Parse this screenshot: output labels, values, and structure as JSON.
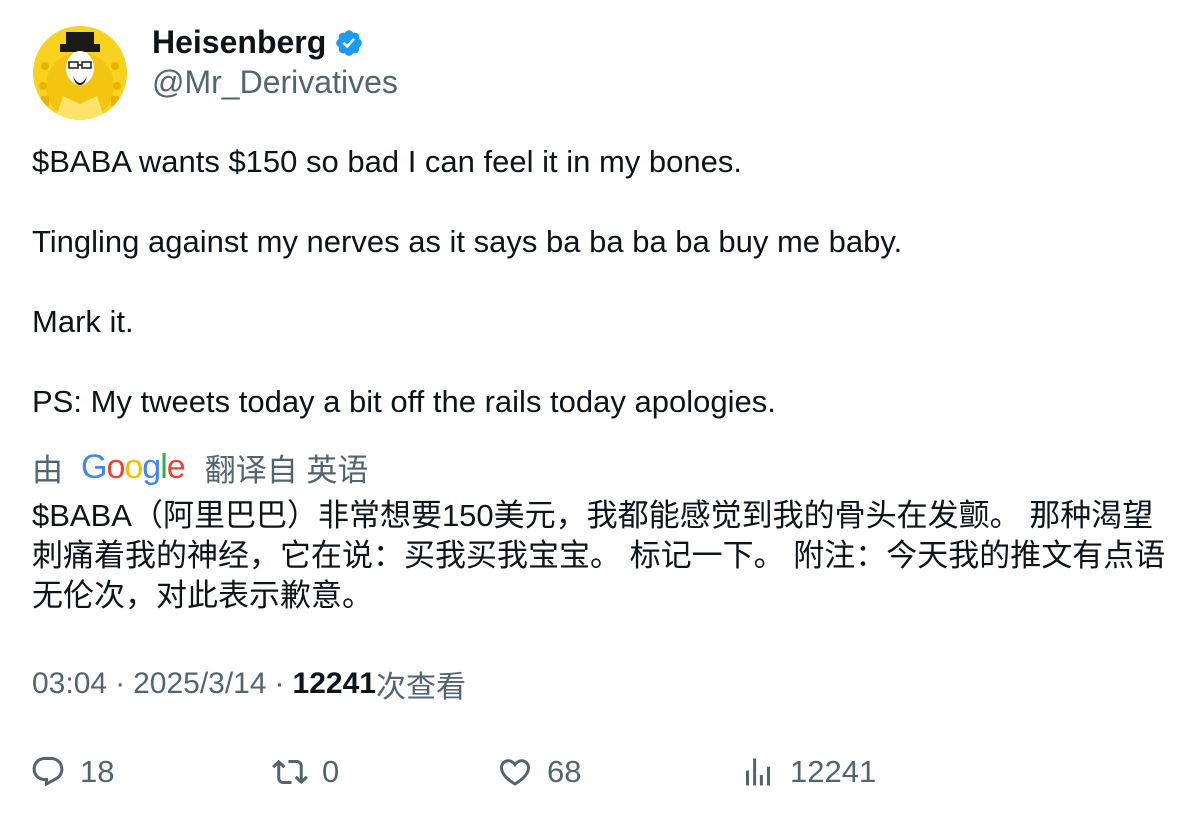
{
  "author": {
    "display_name": "Heisenberg",
    "handle": "@Mr_Derivatives",
    "verified": true,
    "avatar_icon": "heisenberg-avatar",
    "accent_color": "#1d9bf0"
  },
  "tweet": {
    "text": "$BABA wants $150 so bad I can feel it in my bones.\n\nTingling against my nerves as it says ba ba ba ba buy me baby.\n\nMark it.\n\nPS: My tweets today a bit off the rails today apologies."
  },
  "translation": {
    "by_label": "由",
    "provider": "Google",
    "from_label": "翻译自 英语",
    "text": "$BABA（阿里巴巴）非常想要150美元，我都能感觉到我的骨头在发颤。 那种渴望刺痛着我的神经，它在说：买我买我宝宝。 标记一下。 附注：今天我的推文有点语无伦次，对此表示歉意。"
  },
  "meta": {
    "time": "03:04",
    "date": "2025/3/14",
    "views_count": "12241",
    "views_label": "次查看"
  },
  "actions": {
    "replies": "18",
    "retweets": "0",
    "likes": "68",
    "views": "12241"
  }
}
